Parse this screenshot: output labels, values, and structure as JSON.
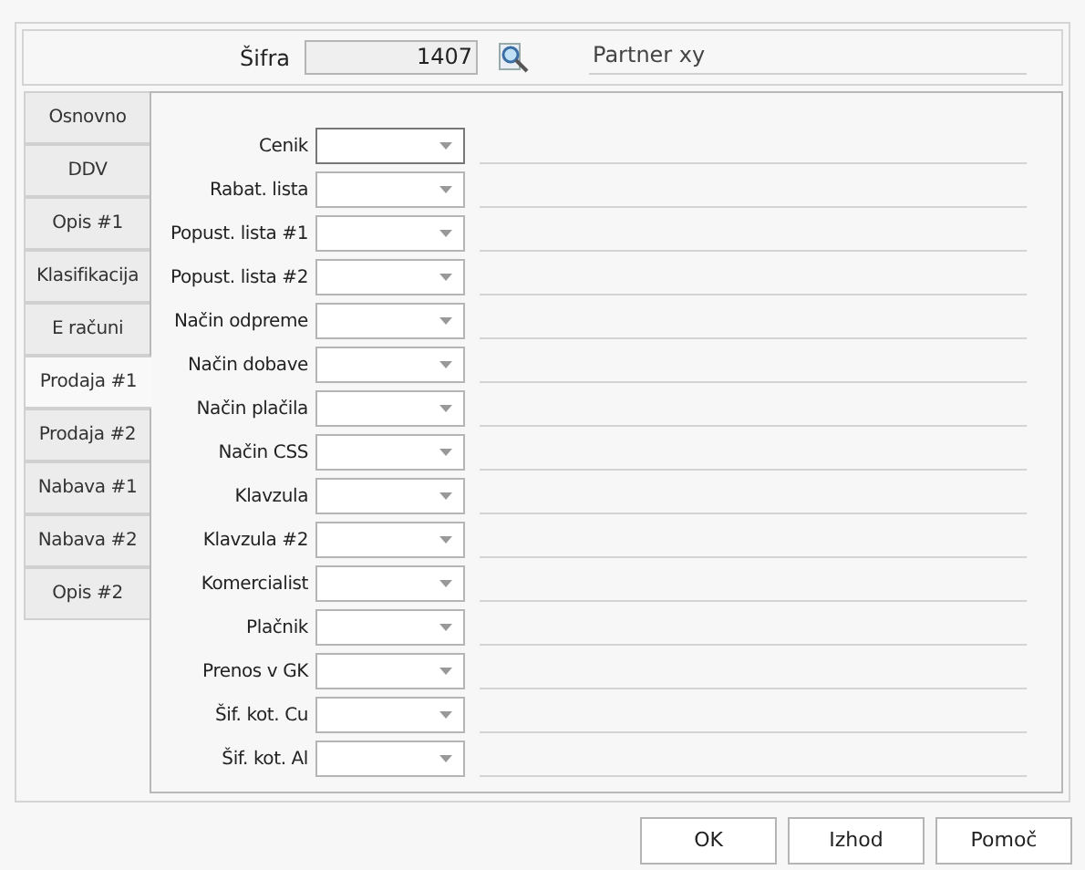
{
  "header": {
    "sifra_label": "Šifra",
    "sifra_value": "1407",
    "partner_name": "Partner xy"
  },
  "tabs": [
    {
      "label": "Osnovno",
      "selected": false
    },
    {
      "label": "DDV",
      "selected": false
    },
    {
      "label": "Opis #1",
      "selected": false
    },
    {
      "label": "Klasifikacija",
      "selected": false
    },
    {
      "label": "E računi",
      "selected": false
    },
    {
      "label": "Prodaja #1",
      "selected": true
    },
    {
      "label": "Prodaja #2",
      "selected": false
    },
    {
      "label": "Nabava #1",
      "selected": false
    },
    {
      "label": "Nabava #2",
      "selected": false
    },
    {
      "label": "Opis #2",
      "selected": false
    }
  ],
  "fields": [
    {
      "label": "Cenik",
      "focused": true
    },
    {
      "label": "Rabat. lista",
      "focused": false
    },
    {
      "label": "Popust. lista #1",
      "focused": false
    },
    {
      "label": "Popust. lista #2",
      "focused": false
    },
    {
      "label": "Način odpreme",
      "focused": false
    },
    {
      "label": "Način dobave",
      "focused": false
    },
    {
      "label": "Način plačila",
      "focused": false
    },
    {
      "label": "Način CSS",
      "focused": false
    },
    {
      "label": "Klavzula",
      "focused": false
    },
    {
      "label": "Klavzula #2",
      "focused": false
    },
    {
      "label": "Komercialist",
      "focused": false
    },
    {
      "label": "Plačnik",
      "focused": false
    },
    {
      "label": "Prenos v GK",
      "focused": false
    },
    {
      "label": "Šif. kot. Cu",
      "focused": false
    },
    {
      "label": "Šif. kot. Al",
      "focused": false
    }
  ],
  "buttons": [
    "OK",
    "Izhod",
    "Pomoč"
  ]
}
